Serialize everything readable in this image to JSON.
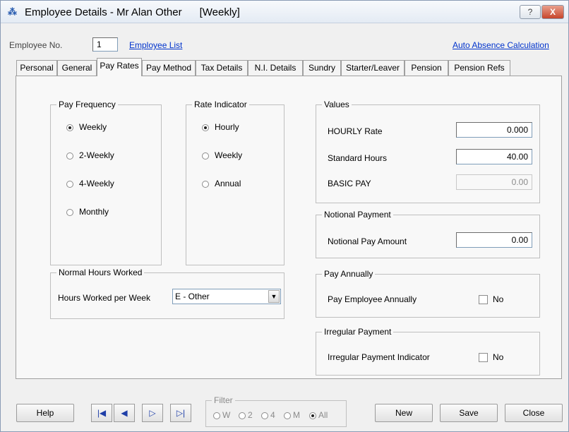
{
  "window": {
    "title": "Employee Details - Mr Alan Other      [Weekly]",
    "help_button": "?",
    "close_button": "X"
  },
  "header": {
    "employee_no_label": "Employee No.",
    "employee_no_value": "1",
    "employee_list_link": "Employee List",
    "auto_absence_link": "Auto Absence Calculation"
  },
  "tabs": [
    {
      "label": "Personal"
    },
    {
      "label": "General"
    },
    {
      "label": "Pay Rates"
    },
    {
      "label": "Pay Method"
    },
    {
      "label": "Tax Details"
    },
    {
      "label": "N.I. Details"
    },
    {
      "label": "Sundry"
    },
    {
      "label": "Starter/Leaver"
    },
    {
      "label": "Pension"
    },
    {
      "label": "Pension Refs"
    }
  ],
  "pay_frequency": {
    "title": "Pay Frequency",
    "options": [
      "Weekly",
      "2-Weekly",
      "4-Weekly",
      "Monthly"
    ],
    "selected": "Weekly"
  },
  "rate_indicator": {
    "title": "Rate Indicator",
    "options": [
      "Hourly",
      "Weekly",
      "Annual"
    ],
    "selected": "Hourly"
  },
  "values": {
    "title": "Values",
    "hourly_rate_label": "HOURLY Rate",
    "hourly_rate_value": "0.000",
    "standard_hours_label": "Standard Hours",
    "standard_hours_value": "40.00",
    "basic_pay_label": "BASIC PAY",
    "basic_pay_value": "0.00"
  },
  "notional_payment": {
    "title": "Notional Payment",
    "amount_label": "Notional Pay Amount",
    "amount_value": "0.00"
  },
  "normal_hours": {
    "title": "Normal Hours Worked",
    "label": "Hours Worked per Week",
    "selected": "E - Other"
  },
  "pay_annually": {
    "title": "Pay Annually",
    "label": "Pay Employee Annually",
    "check_label": "No",
    "checked": false
  },
  "irregular_payment": {
    "title": "Irregular Payment",
    "label": "Irregular Payment Indicator",
    "check_label": "No",
    "checked": false
  },
  "footer": {
    "help": "Help",
    "nav_first": "|◀",
    "nav_prev": "◀",
    "nav_next": "▷",
    "nav_last": "▷|",
    "filter_title": "Filter",
    "filter_options": [
      "W",
      "2",
      "4",
      "M",
      "All"
    ],
    "filter_selected": "All",
    "new": "New",
    "save": "Save",
    "close": "Close"
  }
}
